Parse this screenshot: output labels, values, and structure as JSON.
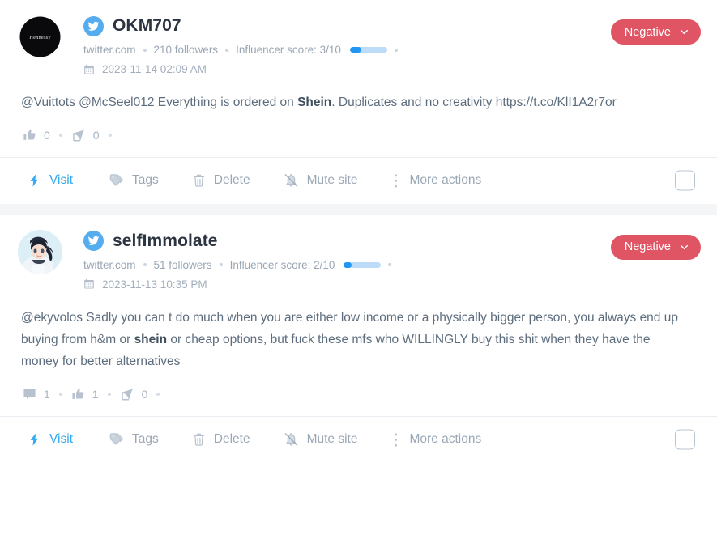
{
  "colors": {
    "negative_badge": "#e05563",
    "twitter_blue": "#55acee",
    "visit_link": "#32a9f0",
    "score_fill": "#2196f3",
    "score_track": "#bcdcf7",
    "page_background": "#f4f5f7"
  },
  "action_bar": {
    "visit_label": "Visit",
    "tags_label": "Tags",
    "delete_label": "Delete",
    "mute_label": "Mute site",
    "more_label": "More actions"
  },
  "posts": [
    {
      "avatar_alt": "Hennessy",
      "avatar_type": "black-circle-hennessy-logo",
      "network_icon": "twitter-icon",
      "username": "OKM707",
      "source": "twitter.com",
      "followers": "210 followers",
      "influencer_score_label": "Influencer score: 3/10",
      "influencer_score_value": 3,
      "influencer_score_max": 10,
      "date": "2023-11-14 02:09 AM",
      "sentiment": "Negative",
      "text_parts": [
        {
          "text": "@Vuittots @McSeel012 Everything is ordered on ",
          "bold": false
        },
        {
          "text": "Shein",
          "bold": true
        },
        {
          "text": ". Duplicates and no creativity https://t.co/KlI1A2r7or",
          "bold": false
        }
      ],
      "engagement": [
        {
          "icon": "thumbs-up-icon",
          "count": "0"
        },
        {
          "icon": "share-icon",
          "count": "0"
        }
      ]
    },
    {
      "avatar_alt": "selfImmolate avatar",
      "avatar_type": "anime-portrait",
      "network_icon": "twitter-icon",
      "username": "selfImmolate",
      "source": "twitter.com",
      "followers": "51 followers",
      "influencer_score_label": "Influencer score: 2/10",
      "influencer_score_value": 2,
      "influencer_score_max": 10,
      "date": "2023-11-13 10:35 PM",
      "sentiment": "Negative",
      "text_parts": [
        {
          "text": "@ekyvolos Sadly you can t do much when you are either low income or a physically bigger person, you always end up buying from h&m or ",
          "bold": false
        },
        {
          "text": "shein",
          "bold": true
        },
        {
          "text": " or cheap options, but fuck these mfs who WILLINGLY buy this shit when they have the money for better alternatives",
          "bold": false
        }
      ],
      "engagement": [
        {
          "icon": "comment-icon",
          "count": "1"
        },
        {
          "icon": "thumbs-up-icon",
          "count": "1"
        },
        {
          "icon": "share-icon",
          "count": "0"
        }
      ]
    }
  ]
}
